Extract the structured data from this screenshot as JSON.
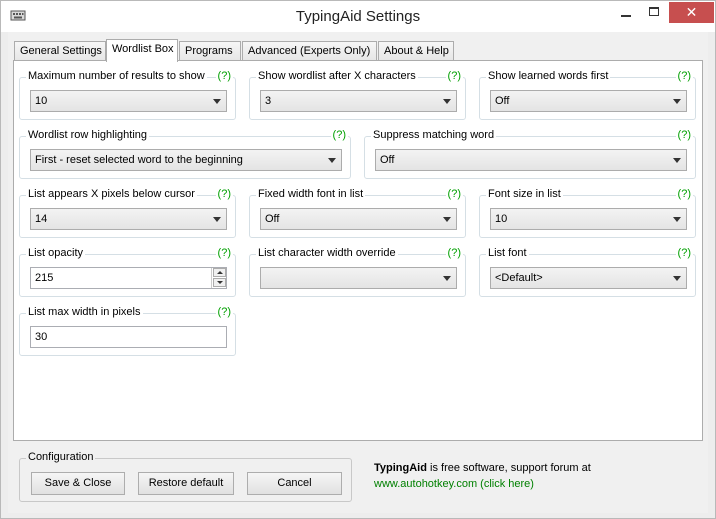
{
  "window": {
    "title": "TypingAid Settings",
    "close_glyph": "✕"
  },
  "tabs": [
    {
      "label": "General Settings"
    },
    {
      "label": "Wordlist Box"
    },
    {
      "label": "Programs"
    },
    {
      "label": "Advanced (Experts Only)"
    },
    {
      "label": "About & Help"
    }
  ],
  "help_text": "(?)",
  "settings": {
    "max_results": {
      "label": "Maximum number of results to show",
      "value": "10"
    },
    "show_after_chars": {
      "label": "Show wordlist after X characters",
      "value": "3"
    },
    "learned_first": {
      "label": "Show learned words first",
      "value": "Off"
    },
    "row_highlighting": {
      "label": "Wordlist row highlighting",
      "value": "First - reset selected word to the beginning"
    },
    "suppress_matching": {
      "label": "Suppress matching word",
      "value": "Off"
    },
    "pixels_below": {
      "label": "List appears X pixels below cursor",
      "value": "14"
    },
    "fixed_width": {
      "label": "Fixed width font in list",
      "value": "Off"
    },
    "font_size": {
      "label": "Font size in list",
      "value": "10"
    },
    "opacity": {
      "label": "List opacity",
      "value": "215"
    },
    "char_width": {
      "label": "List character width override",
      "value": ""
    },
    "list_font": {
      "label": "List font",
      "value": "<Default>"
    },
    "max_width": {
      "label": "List max width in pixels",
      "value": "30"
    }
  },
  "configuration": {
    "label": "Configuration",
    "save_close": "Save & Close",
    "restore_default": "Restore default",
    "cancel": "Cancel"
  },
  "info": {
    "app_name": "TypingAid",
    "text": " is free software, support forum at",
    "link": "www.autohotkey.com (click here)"
  },
  "colors": {
    "help": "#00a000",
    "link": "#008000",
    "close_button": "#c74f4f"
  }
}
